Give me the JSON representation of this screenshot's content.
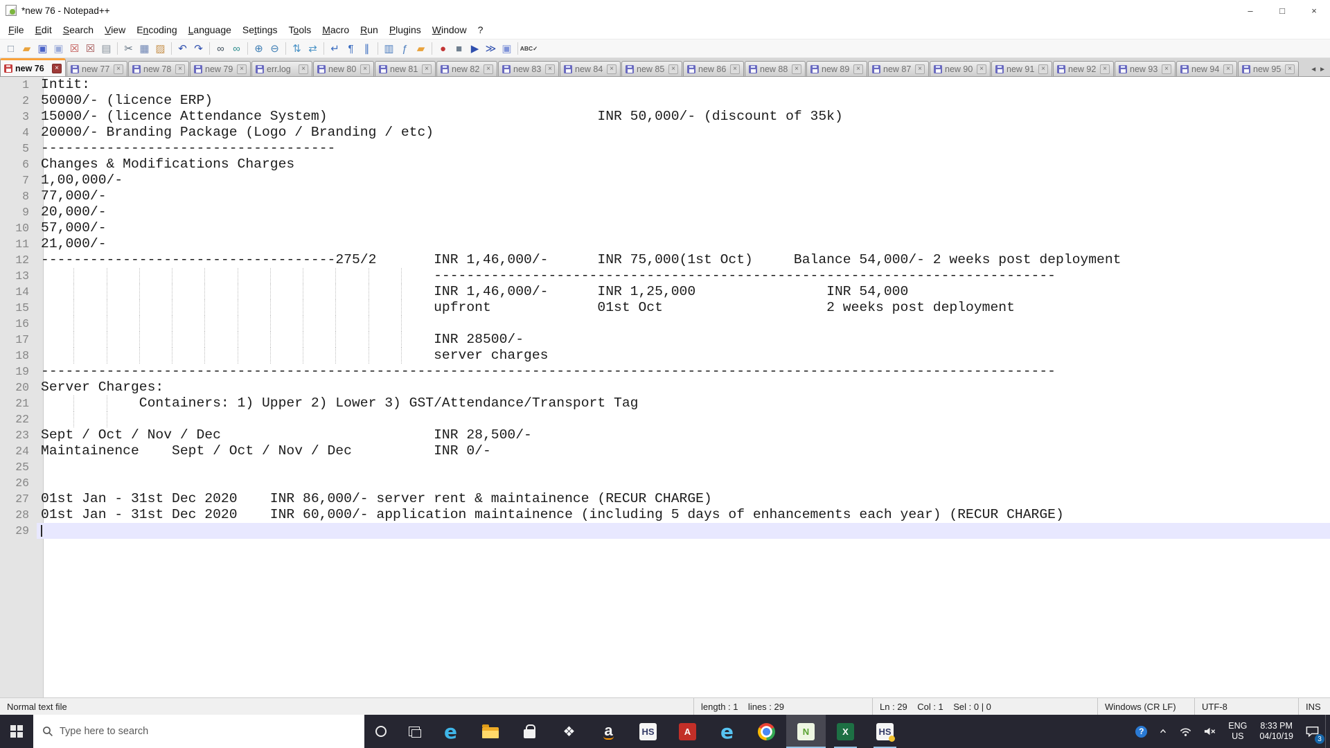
{
  "window": {
    "title": "*new 76 - Notepad++",
    "minimize": "–",
    "maximize": "□",
    "close": "×"
  },
  "menubar": [
    {
      "name": "file",
      "label": "File",
      "u": 0
    },
    {
      "name": "edit",
      "label": "Edit",
      "u": 0
    },
    {
      "name": "search",
      "label": "Search",
      "u": 0
    },
    {
      "name": "view",
      "label": "View",
      "u": 0
    },
    {
      "name": "encoding",
      "label": "Encoding",
      "u": 1
    },
    {
      "name": "language",
      "label": "Language",
      "u": 0
    },
    {
      "name": "settings",
      "label": "Settings",
      "u": 2
    },
    {
      "name": "tools",
      "label": "Tools",
      "u": 1
    },
    {
      "name": "macro",
      "label": "Macro",
      "u": 0
    },
    {
      "name": "run",
      "label": "Run",
      "u": 0
    },
    {
      "name": "plugins",
      "label": "Plugins",
      "u": 0
    },
    {
      "name": "window",
      "label": "Window",
      "u": 0
    },
    {
      "name": "help",
      "label": "?",
      "u": -1
    }
  ],
  "toolbar": [
    {
      "name": "new-file",
      "glyph": "□",
      "color": "#7d8ea0"
    },
    {
      "name": "open-file",
      "glyph": "▰",
      "color": "#e9a23b"
    },
    {
      "name": "save",
      "glyph": "▣",
      "color": "#4a63c8"
    },
    {
      "name": "save-all",
      "glyph": "▣",
      "color": "#9aaad8"
    },
    {
      "name": "close-file",
      "glyph": "☒",
      "color": "#c0504d"
    },
    {
      "name": "close-all",
      "glyph": "☒",
      "color": "#a05050"
    },
    {
      "name": "print",
      "glyph": "▤",
      "color": "#8a949e"
    },
    {
      "sep": true
    },
    {
      "name": "cut",
      "glyph": "✂",
      "color": "#5f6f7f"
    },
    {
      "name": "copy",
      "glyph": "▦",
      "color": "#6f86b4"
    },
    {
      "name": "paste",
      "glyph": "▨",
      "color": "#c79350"
    },
    {
      "sep": true
    },
    {
      "name": "undo",
      "glyph": "↶",
      "color": "#2f4fae"
    },
    {
      "name": "redo",
      "glyph": "↷",
      "color": "#2f4fae"
    },
    {
      "sep": true
    },
    {
      "name": "find",
      "glyph": "∞",
      "color": "#43525f"
    },
    {
      "name": "replace",
      "glyph": "∞",
      "color": "#2f8f8f"
    },
    {
      "sep": true
    },
    {
      "name": "zoom-in",
      "glyph": "⊕",
      "color": "#3f7fb5"
    },
    {
      "name": "zoom-out",
      "glyph": "⊖",
      "color": "#3f7fb5"
    },
    {
      "sep": true
    },
    {
      "name": "sync-vertical-scroll",
      "glyph": "⇅",
      "color": "#4b93c6"
    },
    {
      "name": "sync-horizontal-scroll",
      "glyph": "⇄",
      "color": "#4b93c6"
    },
    {
      "sep": true
    },
    {
      "name": "word-wrap",
      "glyph": "↵",
      "color": "#3a6cc0"
    },
    {
      "name": "show-all-characters",
      "glyph": "¶",
      "color": "#3a6cc0"
    },
    {
      "name": "show-indent-guide",
      "glyph": "∥",
      "color": "#3a6cc0"
    },
    {
      "sep": true
    },
    {
      "name": "document-map",
      "glyph": "▥",
      "color": "#4f7fbf"
    },
    {
      "name": "function-list",
      "glyph": "ƒ",
      "color": "#4f7fbf"
    },
    {
      "name": "folder-as-workspace",
      "glyph": "▰",
      "color": "#e9a23b"
    },
    {
      "sep": true
    },
    {
      "name": "record-macro",
      "glyph": "●",
      "color": "#c23434"
    },
    {
      "name": "stop-recording",
      "glyph": "■",
      "color": "#6f7f8f"
    },
    {
      "name": "playback-macro",
      "glyph": "▶",
      "color": "#2f4fae"
    },
    {
      "name": "run-macro-multiple",
      "glyph": "≫",
      "color": "#2f4fae"
    },
    {
      "name": "save-macro",
      "glyph": "▣",
      "color": "#7f93d8"
    },
    {
      "sep": true
    },
    {
      "name": "spell-check",
      "glyph": "ABC✓",
      "color": "#3a3a3a",
      "small": true
    }
  ],
  "tabbar": {
    "close_glyph": "×",
    "scroll_left": "◄",
    "scroll_right": "►",
    "tabs": [
      {
        "label": "new 76",
        "active": true,
        "modified": true
      },
      {
        "label": "new 77"
      },
      {
        "label": "new 78"
      },
      {
        "label": "new 79"
      },
      {
        "label": "err.log"
      },
      {
        "label": "new 80"
      },
      {
        "label": "new 81"
      },
      {
        "label": "new 82"
      },
      {
        "label": "new 83"
      },
      {
        "label": "new 84"
      },
      {
        "label": "new 85"
      },
      {
        "label": "new 86"
      },
      {
        "label": "new 88"
      },
      {
        "label": "new 89"
      },
      {
        "label": "new 87"
      },
      {
        "label": "new 90"
      },
      {
        "label": "new 91"
      },
      {
        "label": "new 92"
      },
      {
        "label": "new 93"
      },
      {
        "label": "new 94"
      },
      {
        "label": "new 95"
      }
    ]
  },
  "editor": {
    "current_line": 29,
    "lines": [
      {
        "n": 1,
        "s": [
          {
            "c": 0,
            "t": "Intit:"
          }
        ]
      },
      {
        "n": 2,
        "s": [
          {
            "c": 0,
            "t": "50000/- (licence ERP)"
          }
        ]
      },
      {
        "n": 3,
        "s": [
          {
            "c": 0,
            "t": "15000/- (licence Attendance System)"
          },
          {
            "c": 68,
            "t": "INR 50,000/- (discount of 35k)"
          }
        ]
      },
      {
        "n": 4,
        "s": [
          {
            "c": 0,
            "t": "20000/- Branding Package (Logo / Branding / etc)"
          }
        ]
      },
      {
        "n": 5,
        "s": [
          {
            "c": 0,
            "d": 36
          }
        ]
      },
      {
        "n": 6,
        "s": [
          {
            "c": 0,
            "t": "Changes & Modifications Charges"
          }
        ]
      },
      {
        "n": 7,
        "s": [
          {
            "c": 0,
            "t": "1,00,000/-"
          }
        ]
      },
      {
        "n": 8,
        "s": [
          {
            "c": 0,
            "t": "77,000/-"
          }
        ]
      },
      {
        "n": 9,
        "s": [
          {
            "c": 0,
            "t": "20,000/-"
          }
        ]
      },
      {
        "n": 10,
        "s": [
          {
            "c": 0,
            "t": "57,000/-"
          }
        ]
      },
      {
        "n": 11,
        "s": [
          {
            "c": 0,
            "t": "21,000/-"
          }
        ]
      },
      {
        "n": 12,
        "s": [
          {
            "c": 0,
            "d": 36
          },
          {
            "c": 36,
            "t": "275/2"
          },
          {
            "c": 48,
            "t": "INR 1,46,000/-"
          },
          {
            "c": 68,
            "t": "INR 75,000(1st Oct)"
          },
          {
            "c": 92,
            "t": "Balance 54,000/- 2 weeks post deployment"
          }
        ]
      },
      {
        "n": 13,
        "g": [
          4,
          8,
          12,
          16,
          20,
          24,
          28,
          32,
          36,
          40,
          44
        ],
        "s": [
          {
            "c": 48,
            "d": 76
          }
        ]
      },
      {
        "n": 14,
        "g": [
          4,
          8,
          12,
          16,
          20,
          24,
          28,
          32,
          36,
          40,
          44
        ],
        "s": [
          {
            "c": 48,
            "t": "INR 1,46,000/-"
          },
          {
            "c": 68,
            "t": "INR 1,25,000"
          },
          {
            "c": 96,
            "t": "INR 54,000"
          }
        ]
      },
      {
        "n": 15,
        "g": [
          4,
          8,
          12,
          16,
          20,
          24,
          28,
          32,
          36,
          40,
          44
        ],
        "s": [
          {
            "c": 48,
            "t": "upfront"
          },
          {
            "c": 68,
            "t": "01st Oct"
          },
          {
            "c": 96,
            "t": "2 weeks post deployment"
          }
        ]
      },
      {
        "n": 16,
        "g": [
          4,
          8,
          12,
          16,
          20,
          24,
          28,
          32,
          36,
          40,
          44
        ],
        "s": []
      },
      {
        "n": 17,
        "g": [
          4,
          8,
          12,
          16,
          20,
          24,
          28,
          32,
          36,
          40,
          44
        ],
        "s": [
          {
            "c": 48,
            "t": "INR 28500/-"
          }
        ]
      },
      {
        "n": 18,
        "g": [
          4,
          8,
          12,
          16,
          20,
          24,
          28,
          32,
          36,
          40,
          44
        ],
        "s": [
          {
            "c": 48,
            "t": "server charges"
          }
        ]
      },
      {
        "n": 19,
        "s": [
          {
            "c": 0,
            "d": 124
          }
        ]
      },
      {
        "n": 20,
        "s": [
          {
            "c": 0,
            "t": "Server Charges:"
          }
        ]
      },
      {
        "n": 21,
        "g": [
          4,
          8
        ],
        "s": [
          {
            "c": 12,
            "t": "Containers: 1) Upper 2) Lower 3) GST/Attendance/Transport Tag"
          }
        ]
      },
      {
        "n": 22,
        "g": [
          4,
          8
        ],
        "s": []
      },
      {
        "n": 23,
        "s": [
          {
            "c": 0,
            "t": "Sept / Oct / Nov / Dec"
          },
          {
            "c": 48,
            "t": "INR 28,500/-"
          }
        ]
      },
      {
        "n": 24,
        "s": [
          {
            "c": 0,
            "t": "Maintainence"
          },
          {
            "c": 16,
            "t": "Sept / Oct / Nov / Dec"
          },
          {
            "c": 48,
            "t": "INR 0/-"
          }
        ]
      },
      {
        "n": 25,
        "s": []
      },
      {
        "n": 26,
        "s": []
      },
      {
        "n": 27,
        "s": [
          {
            "c": 0,
            "t": "01st Jan - 31st Dec 2020"
          },
          {
            "c": 28,
            "t": "INR 86,000/- server rent & maintainence (RECUR CHARGE)"
          }
        ]
      },
      {
        "n": 28,
        "s": [
          {
            "c": 0,
            "t": "01st Jan - 31st Dec 2020"
          },
          {
            "c": 28,
            "t": "INR 60,000/- application maintainence (including 5 days of enhancements each year) (RECUR CHARGE)"
          }
        ]
      },
      {
        "n": 29,
        "s": []
      }
    ]
  },
  "statusbar": {
    "doc_type": "Normal text file",
    "doc_info": "length : 1    lines : 29",
    "cursor": "Ln : 29    Col : 1    Sel : 0 | 0",
    "eol": "Windows (CR LF)",
    "encoding": "UTF-8",
    "typing_mode": "INS"
  },
  "taskbar": {
    "search_placeholder": "Type here to search",
    "apps": [
      {
        "name": "edge",
        "kind": "letter",
        "char": "e",
        "color": "#3fb6e8"
      },
      {
        "name": "file-explorer",
        "kind": "folder"
      },
      {
        "name": "microsoft-store",
        "kind": "bag"
      },
      {
        "name": "dropbox",
        "kind": "glyph",
        "char": "❖",
        "color": "#f5f6f7"
      },
      {
        "name": "amazon",
        "kind": "amazon",
        "char": "a"
      },
      {
        "name": "hs-app",
        "kind": "tile",
        "bg": "#f5f5f5",
        "label": "HS",
        "fg": "#333a66"
      },
      {
        "name": "adobe-acrobat",
        "kind": "tile",
        "bg": "#c22f28",
        "label": "A",
        "fg": "#ffffff"
      },
      {
        "name": "internet-explorer",
        "kind": "letter",
        "char": "e",
        "color": "#57c4f2"
      },
      {
        "name": "chrome",
        "kind": "chrome"
      },
      {
        "name": "notepad-plus-plus",
        "kind": "tile",
        "bg": "#eef6e2",
        "label": "N",
        "fg": "#58a12f",
        "active": true,
        "running": true
      },
      {
        "name": "excel",
        "kind": "tile",
        "bg": "#1d7044",
        "label": "X",
        "fg": "#ffffff",
        "running": true
      },
      {
        "name": "hs-app-2",
        "kind": "tile",
        "bg": "#f5f5f5",
        "label": "HS",
        "fg": "#333a66",
        "running": true,
        "dot": true
      }
    ],
    "tray": {
      "help_glyph": "?",
      "chevron": "⌃",
      "lang": [
        "ENG",
        "US"
      ],
      "clock": [
        "8:33 PM",
        "04/10/19"
      ],
      "notification_badge": "3"
    }
  }
}
